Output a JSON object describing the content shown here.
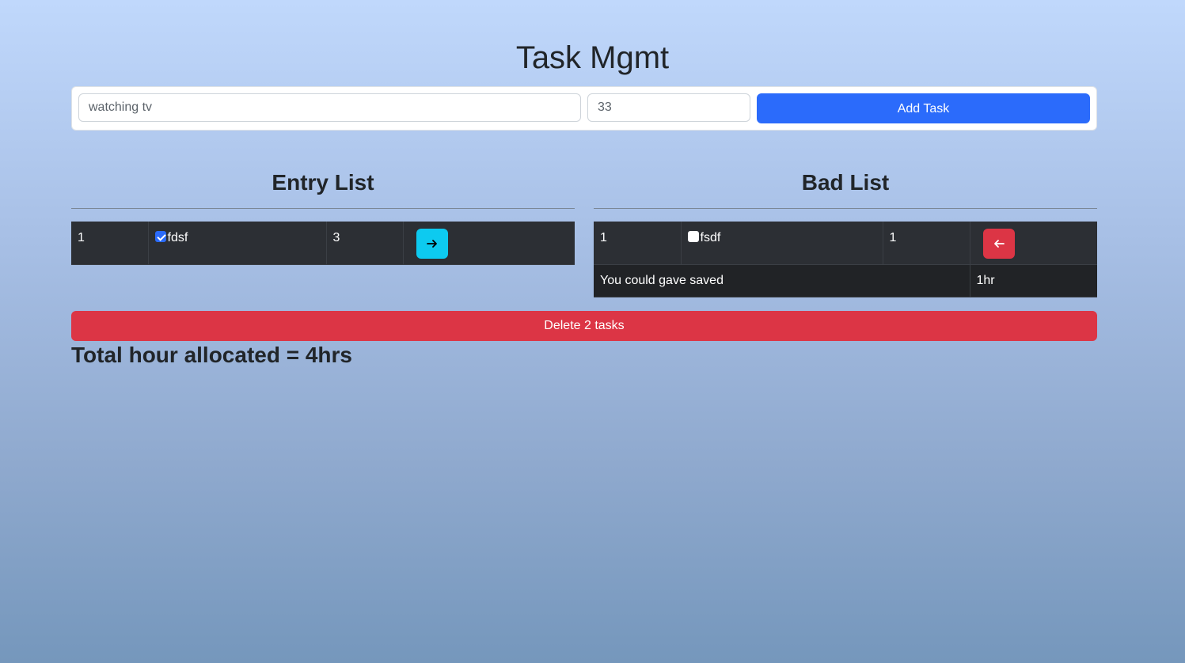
{
  "page": {
    "title": "Task Mgmt"
  },
  "form": {
    "task_value": "watching tv",
    "hours_value": "33",
    "add_label": "Add Task"
  },
  "entry_list": {
    "title": "Entry List",
    "rows": [
      {
        "index": "1",
        "checked": true,
        "task": "fdsf",
        "hours": "3",
        "action_icon": "arrow-right-icon"
      }
    ]
  },
  "bad_list": {
    "title": "Bad List",
    "rows": [
      {
        "index": "1",
        "checked": false,
        "task": "fsdf",
        "hours": "1",
        "action_icon": "arrow-left-icon"
      }
    ],
    "saved_label": "You could gave saved",
    "saved_value": "1hr"
  },
  "delete_label": "Delete 2 tasks",
  "total_label": "Total hour allocated = 4hrs",
  "colors": {
    "primary": "#2b6bfb",
    "danger": "#dc3545",
    "info": "#0dcaf0",
    "table_dark": "#2c2f34"
  }
}
